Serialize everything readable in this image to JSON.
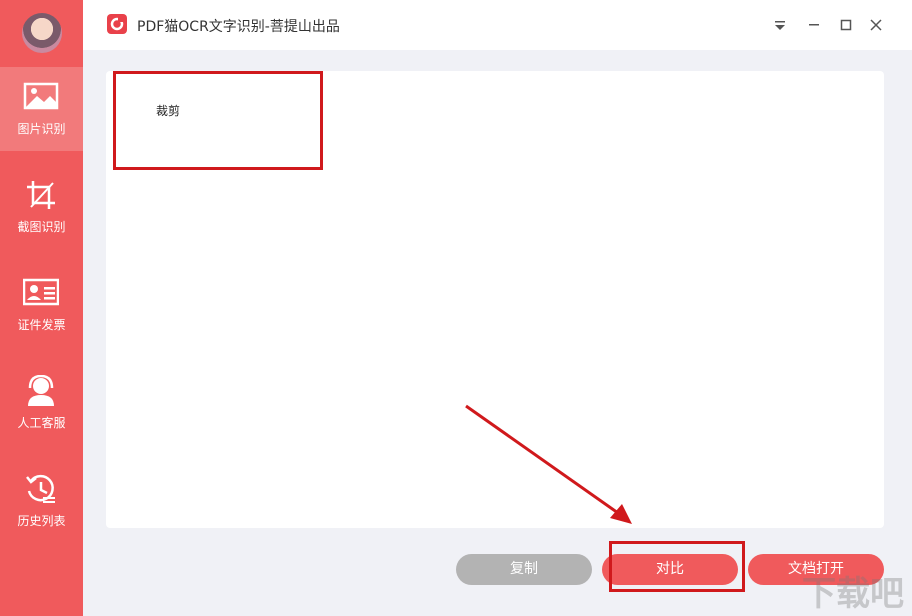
{
  "app": {
    "title": "PDF猫OCR文字识别-菩提山出品"
  },
  "sidebar": {
    "items": [
      {
        "label": "图片识别",
        "icon": "image-icon",
        "active": true
      },
      {
        "label": "截图识别",
        "icon": "crop-icon",
        "active": false
      },
      {
        "label": "证件发票",
        "icon": "id-card-icon",
        "active": false
      },
      {
        "label": "人工客服",
        "icon": "headset-icon",
        "active": false
      },
      {
        "label": "历史列表",
        "icon": "history-icon",
        "active": false
      }
    ]
  },
  "content": {
    "text": "裁剪"
  },
  "buttons": {
    "copy": "复制",
    "compare": "对比",
    "open": "文档打开"
  },
  "watermark": "下载吧"
}
